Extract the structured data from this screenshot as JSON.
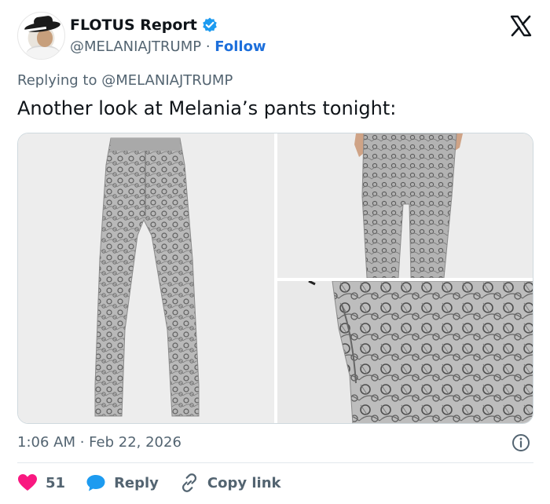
{
  "author": {
    "display_name": "FLOTUS Report",
    "handle": "@MELANIAJTRUMP",
    "separator": " · ",
    "follow_label": "Follow"
  },
  "tweet": {
    "replying_to": "Replying to @MELANIAJTRUMP",
    "text": "Another look at Melania’s pants tonight:",
    "timestamp": "1:06 AM · Feb 22, 2026"
  },
  "actions": {
    "likes_count": "51",
    "reply_label": "Reply",
    "copy_link_label": "Copy link"
  },
  "icons": [
    "verified-badge-icon",
    "x-logo-icon",
    "info-icon",
    "heart-icon",
    "reply-bubble-icon",
    "link-icon"
  ],
  "colors": {
    "link_blue": "#1d6fdb",
    "verified_blue": "#1d9bf0",
    "like_pink": "#f91880",
    "muted_text": "#536471"
  }
}
